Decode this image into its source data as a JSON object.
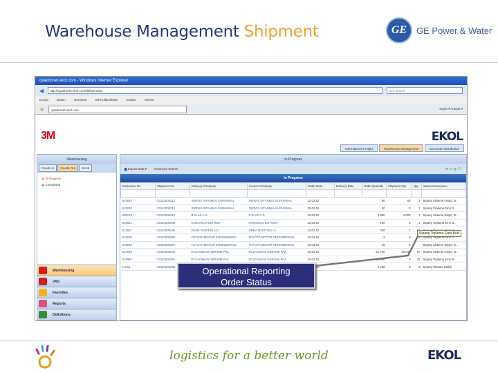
{
  "slide": {
    "title_main": "Warehouse Management",
    "title_accent": "Shipment",
    "partner_logo": "GE Power & Water",
    "seal": "GE",
    "tagline": "logistics for a better world",
    "footer_logo": "EKOL"
  },
  "browser": {
    "title": "quadronet.ekol.com - Windows Internet Explorer",
    "url": "http://quadronet.ekol.com/default.aspx",
    "search_placeholder": "Live Search",
    "menu": [
      "Dosya",
      "Düzen",
      "Görünüm",
      "Sık Kullanılanlar",
      "Araçlar",
      "Yardım"
    ],
    "tab": "quadronet.ekol.com",
    "right_tools": "Sayfa ▾  Araçlar ▾"
  },
  "app": {
    "customer_logo": "3M",
    "brand_logo": "EKOL",
    "top_tabs": [
      {
        "label": "International Freight"
      },
      {
        "label": "Warehouse Management",
        "active": true
      },
      {
        "label": "Domestic Distribution"
      }
    ],
    "left": {
      "header": "Warehousing",
      "tabs": [
        {
          "label": "Goods In"
        },
        {
          "label": "Goods Out",
          "active": true
        },
        {
          "label": "Stock"
        }
      ],
      "tree": [
        {
          "label": "In Progress",
          "active": true
        },
        {
          "label": "Completed"
        }
      ],
      "nav": [
        {
          "label": "Warehousing",
          "active": true,
          "color": "#d21f1f"
        },
        {
          "label": "VAS",
          "color": "#d21f1f"
        },
        {
          "label": "Favorites",
          "color": "#f2b320"
        },
        {
          "label": "Reports",
          "color": "#e0507a"
        },
        {
          "label": "Definitions",
          "color": "#3a8a3a"
        }
      ]
    },
    "right": {
      "header": "In Progress",
      "export": "Export Data ▾",
      "advanced": "Advanced Search",
      "band": "In Progress",
      "columns": [
        "Reference No",
        "Shipment No",
        "Delivery Company",
        "Invoice Company",
        "Order Date",
        "Delivery Date",
        "Order Quantity",
        "Shipment Qty",
        "Qty",
        "Status Description"
      ],
      "rows": [
        [
          "613654",
          "C0110000212",
          "SERVIS ISTANBUL KURUMSAL",
          "SERVIS ISTANBUL KURUMSAL",
          "22.02.10",
          "",
          "60",
          "60",
          "1",
          "Sipariş Sisteme Düştü, B..."
        ],
        [
          "613200",
          "C0110000213",
          "SERVIS ISTANBUL KURUMSAL",
          "SERVIS ISTANBUL KURUMSAL",
          "22.02.10",
          "",
          "20",
          "0",
          "2",
          "Sipariş Toplama Emri B..."
        ],
        [
          "608769",
          "C0110000212",
          "B PLAS A.S.",
          "B PLAS A.S.",
          "22.02.10",
          "",
          "4.000",
          "4.000",
          "1",
          "Sipariş Sisteme Düştü, B..."
        ],
        [
          "613651",
          "C0110000288",
          "KADIOGLU ILETISIM",
          "KADIOGLU ILETISIM",
          "22.02.10",
          "",
          "100",
          "0",
          "1",
          "Sipariş Toplama Emri B..."
        ],
        [
          "613637",
          "C0110000285",
          "DEMA DAGITIM A.S.",
          "DEMA DAGITIM A.S.",
          "22.02.10",
          "",
          "250",
          "1",
          "10",
          "Sipariş Toplama Emri B..."
        ],
        [
          "613639",
          "C0110000284",
          "TOYOTA MOTOR ENGINEERING",
          "TOYOTA MOTOR ENGINEERING",
          "22.02.10",
          "",
          "2",
          "0",
          "2",
          "Sipariş Toplama Emri B..."
        ],
        [
          "613633",
          "C0110000287",
          "TOYOTA MOTOR ENGINEERING",
          "TOYOTA MOTOR ENGINEERING",
          "22.02.10",
          "",
          "45",
          "0",
          "",
          "Sipariş Sisteme Düştü, B..."
        ],
        [
          "613993",
          "C0110000282",
          "ECZACIBASI GERISIM PAZ.",
          "ECZACIBASI GERISIM PAZ.",
          "22.02.10",
          "",
          "51.760",
          "26.440",
          "97",
          "Sipariş Sisteme Düştü, B..."
        ],
        [
          "613994",
          "C0110000281",
          "ECZACIBASI GERISIM PAZ.",
          "ECZACIBASI GERISIM PAZ.",
          "22.02.10",
          "",
          "50.000",
          "0",
          "32",
          "Sipariş Toplama Emri B..."
        ],
        [
          "1.0mg",
          "C0110000280",
          "",
          "",
          "22.02.10",
          "",
          "2.700",
          "0",
          "2",
          "Sipariş Allocate Edildi"
        ]
      ],
      "tooltip": "Sipariş Toplama Emri Bekl"
    }
  },
  "callout": {
    "line1": "Operational Reporting",
    "line2": "Order Status"
  }
}
